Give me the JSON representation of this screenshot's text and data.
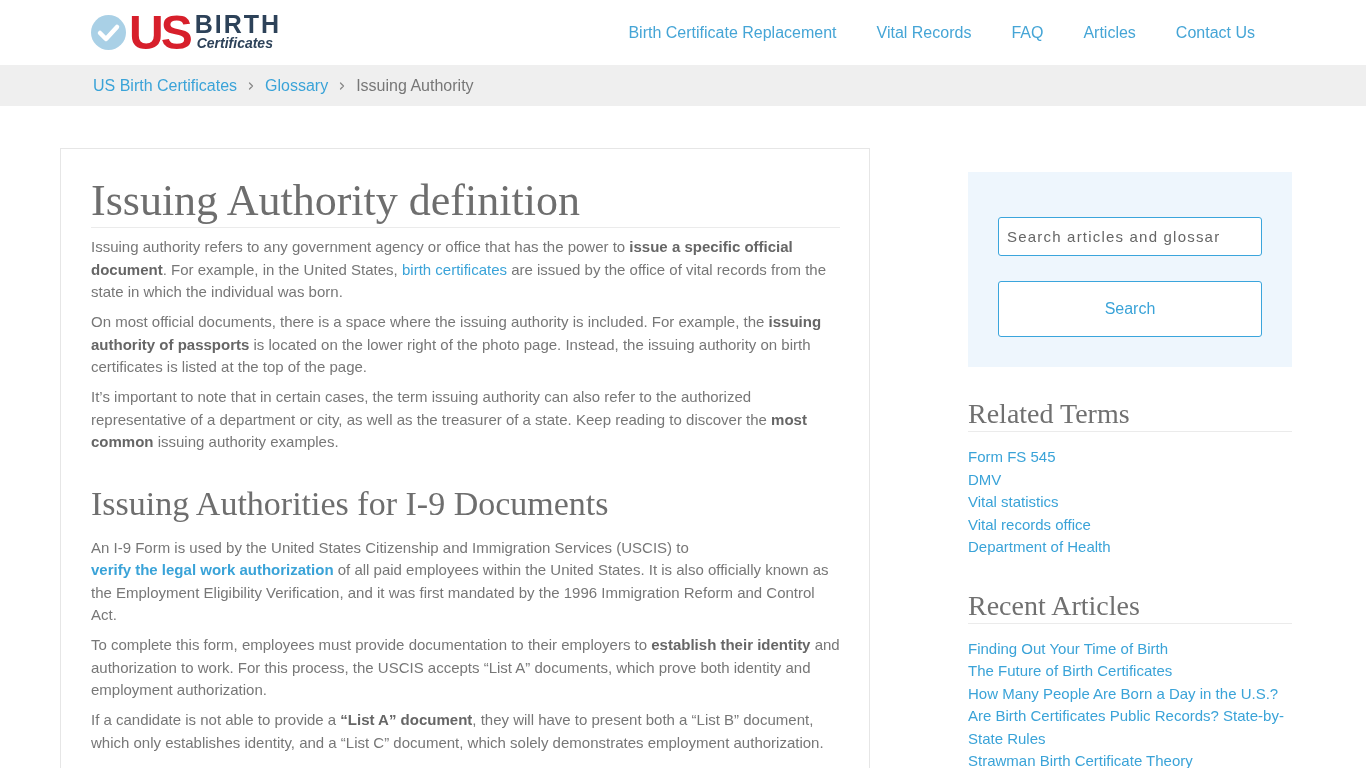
{
  "header": {
    "logo": {
      "mark": "US",
      "word": "BIRTH",
      "sub": "Certificates"
    },
    "nav": [
      {
        "label": "Birth Certificate Replacement"
      },
      {
        "label": "Vital Records"
      },
      {
        "label": "FAQ"
      },
      {
        "label": "Articles"
      },
      {
        "label": "Contact Us"
      }
    ]
  },
  "breadcrumb": [
    {
      "label": "US Birth Certificates",
      "kind": "link"
    },
    {
      "label": "Glossary",
      "kind": "link"
    },
    {
      "label": "Issuing Authority",
      "kind": "current"
    }
  ],
  "article": {
    "title": "Issuing Authority definition",
    "intro": [
      {
        "parts": [
          {
            "kind": "text",
            "text": "Issuing authority refers to any government agency or office that has the power to **issue a specific official document**. For example, in the United States, "
          },
          {
            "kind": "link",
            "text": "birth certificates",
            "bold": false
          },
          {
            "kind": "text",
            "text": " are issued by the office of vital records from the state in which the individual was born."
          }
        ]
      },
      {
        "parts": [
          {
            "kind": "text",
            "text": "On most official documents, there is a space where the issuing authority is included. For example, the **issuing authority of passports** is located on the lower right of the photo page. Instead, the issuing authority on birth certificates is listed at the top of the page."
          }
        ]
      },
      {
        "parts": [
          {
            "kind": "text",
            "text": "It’s important to note that in certain cases, the term issuing authority can also refer to the authorized representative of a department or city, as well as the treasurer of a state. Keep reading to discover the **most common** issuing authority examples."
          }
        ]
      }
    ],
    "sections": [
      {
        "heading": "Issuing Authorities for I-9 Documents",
        "paragraphs": [
          {
            "parts": [
              {
                "kind": "text",
                "text": "An I-9 Form is used by the United States Citizenship and Immigration Services (USCIS) to "
              },
              {
                "kind": "link",
                "text": "verify the legal work authorization",
                "bold": true
              },
              {
                "kind": "text",
                "text": " of all paid employees within the United States. It is also officially known as the Employment Eligibility Verification, and it was first mandated by the 1996 Immigration Reform and Control Act."
              }
            ]
          },
          {
            "parts": [
              {
                "kind": "text",
                "text": "To complete this form, employees must provide documentation to their employers to **establish their identity** and authorization to work. For this process, the USCIS accepts “List A” documents, which prove both identity and employment authorization."
              }
            ]
          },
          {
            "parts": [
              {
                "kind": "text",
                "text": "If a candidate is not able to provide a **“List A” document**, they will have to present both a “List B” document, which only establishes identity, and a “List C” document, which solely demonstrates employment authorization."
              }
            ]
          }
        ]
      }
    ]
  },
  "sidebar": {
    "search": {
      "placeholder": "Search articles and glossar",
      "button": "Search"
    },
    "related_terms": {
      "title": "Related Terms",
      "items": [
        "Form FS 545",
        "DMV",
        "Vital statistics",
        "Vital records office",
        "Department of Health"
      ]
    },
    "recent_articles": {
      "title": "Recent Articles",
      "items": [
        "Finding Out Your Time of Birth",
        "The Future of Birth Certificates",
        "How Many People Are Born a Day in the U.S.?",
        "Are Birth Certificates Public Records? State-by-State Rules",
        "Strawman Birth Certificate Theory"
      ]
    }
  }
}
